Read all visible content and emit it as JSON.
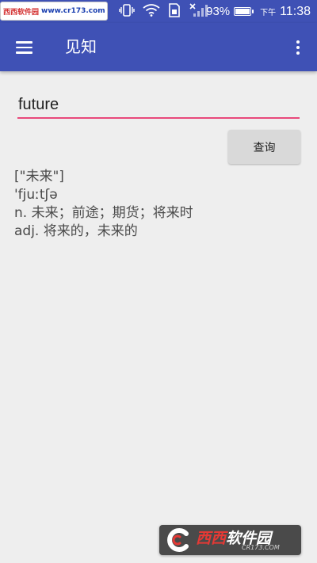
{
  "status_bar": {
    "watermark_cn": "西西软件园",
    "watermark_url": "www.cr173.com",
    "battery_percent": "93%",
    "battery_level": 0.93,
    "ampm": "下午",
    "time": "11:38",
    "icons": [
      "usb-icon",
      "vibrate-icon",
      "wifi-icon",
      "sim-icon",
      "signal-icon"
    ]
  },
  "app_bar": {
    "title": "见知",
    "menu_icon": "hamburger-menu-icon",
    "overflow_icon": "more-vert-icon",
    "color": "#3f51b5"
  },
  "search": {
    "value": "future",
    "underline_color": "#e8487a"
  },
  "query_button": {
    "label": "查询"
  },
  "result": {
    "translation": "[\"未来\"]",
    "phonetic": "'fjuːtʃə",
    "definitions": [
      "n. 未来；前途；期货；将来时",
      "adj. 将来的，未来的"
    ]
  },
  "watermark": {
    "brand_red": "西西",
    "brand_white": "软件园",
    "url": "CR173.COM"
  }
}
